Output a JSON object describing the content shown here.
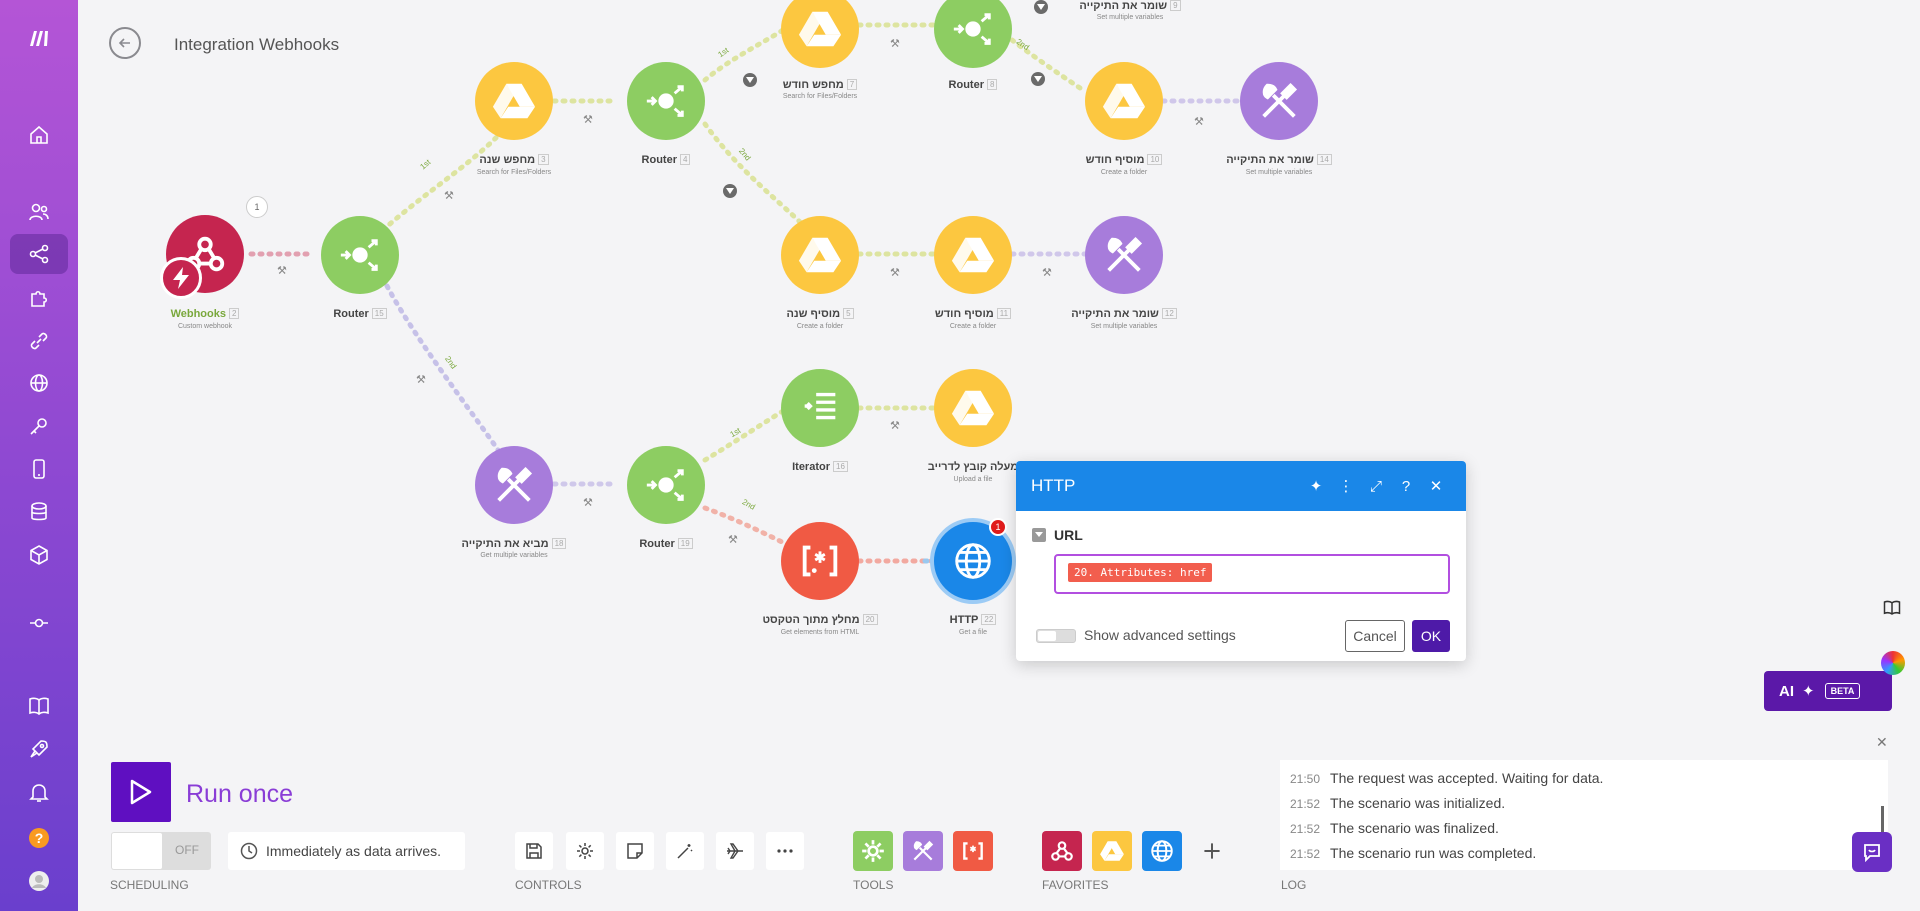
{
  "scenario": {
    "title": "Integration Webhooks"
  },
  "canvas": {
    "webhook_badge": "1",
    "http_error_badge": "1",
    "route_labels": [
      "1st",
      "2nd",
      "1st",
      "2nd",
      "1st",
      "2nd",
      "1st",
      "2nd"
    ],
    "nodes": [
      {
        "id": "webhooks",
        "label": "Webhooks",
        "num": "2",
        "sub": "Custom webhook",
        "color": "#c5254f"
      },
      {
        "id": "router-1",
        "label": "Router",
        "num": "15",
        "sub": "",
        "color": "#8dcd62"
      },
      {
        "id": "search-year",
        "label": "מחפש שנה",
        "num": "3",
        "sub": "Search for Files/Folders",
        "color": "#fcc740"
      },
      {
        "id": "router-4",
        "label": "Router",
        "num": "4",
        "sub": "",
        "color": "#8dcd62"
      },
      {
        "id": "search-month",
        "label": "מחפש חודש",
        "num": "7",
        "sub": "Search for Files/Folders",
        "color": "#fcc740"
      },
      {
        "id": "router-8",
        "label": "Router",
        "num": "8",
        "sub": "",
        "color": "#8dcd62"
      },
      {
        "id": "saves-folder-top",
        "label": "שומר את התיקייה",
        "num": "9",
        "sub": "Set multiple variables",
        "color": "#a77cdb"
      },
      {
        "id": "add-month-top",
        "label": "מוסיף חודש",
        "num": "10",
        "sub": "Create a folder",
        "color": "#fcc740"
      },
      {
        "id": "saves-folder-14",
        "label": "שומר את התיקייה",
        "num": "14",
        "sub": "Set multiple variables",
        "color": "#a77cdb"
      },
      {
        "id": "add-year",
        "label": "מוסיף שנה",
        "num": "5",
        "sub": "Create a folder",
        "color": "#fcc740"
      },
      {
        "id": "add-month",
        "label": "מוסיף חודש",
        "num": "11",
        "sub": "Create a folder",
        "color": "#fcc740"
      },
      {
        "id": "saves-folder-12",
        "label": "שומר את התיקייה",
        "num": "12",
        "sub": "Set multiple variables",
        "color": "#a77cdb"
      },
      {
        "id": "iterator",
        "label": "Iterator",
        "num": "16",
        "sub": "",
        "color": "#8dcd62"
      },
      {
        "id": "upload-file",
        "label": "מעלה קובץ לדרייב",
        "num": "",
        "sub": "Upload a file",
        "color": "#fcc740"
      },
      {
        "id": "gets-folder",
        "label": "מביא את התיקייה",
        "num": "18",
        "sub": "Get multiple variables",
        "color": "#a77cdb"
      },
      {
        "id": "router-19",
        "label": "Router",
        "num": "19",
        "sub": "",
        "color": "#8dcd62"
      },
      {
        "id": "extract-text",
        "label": "מחלץ מתוך הטקסט",
        "num": "20",
        "sub": "Get elements from HTML",
        "color": "#f05a44"
      },
      {
        "id": "http",
        "label": "HTTP",
        "num": "22",
        "sub": "Get a file",
        "color": "#1a87e8"
      }
    ]
  },
  "dialog": {
    "title": "HTTP",
    "field_label": "URL",
    "url_value": "20. Attributes: href",
    "advanced_label": "Show advanced settings",
    "cancel_label": "Cancel",
    "ok_label": "OK"
  },
  "ai": {
    "label": "AI",
    "badge": "BETA"
  },
  "bottom": {
    "run_once_label": "Run once",
    "schedule_toggle": "OFF",
    "schedule_text": "Immediately as data arrives.",
    "captions": {
      "scheduling": "SCHEDULING",
      "controls": "CONTROLS",
      "tools": "TOOLS",
      "favorites": "FAVORITES",
      "log": "LOG"
    }
  },
  "log": [
    {
      "time": "21:50",
      "text": "The request was accepted. Waiting for data."
    },
    {
      "time": "21:52",
      "text": "The scenario was initialized."
    },
    {
      "time": "21:52",
      "text": "The scenario was finalized."
    },
    {
      "time": "21:52",
      "text": "The scenario run was completed."
    }
  ],
  "colors": {
    "accent": "#6a3fcd",
    "router": "#8dcd62",
    "drive": "#fcc740",
    "tools": "#a77cdb",
    "http": "#1a87e8",
    "text_parser": "#f05a44",
    "webhook": "#c5254f"
  }
}
